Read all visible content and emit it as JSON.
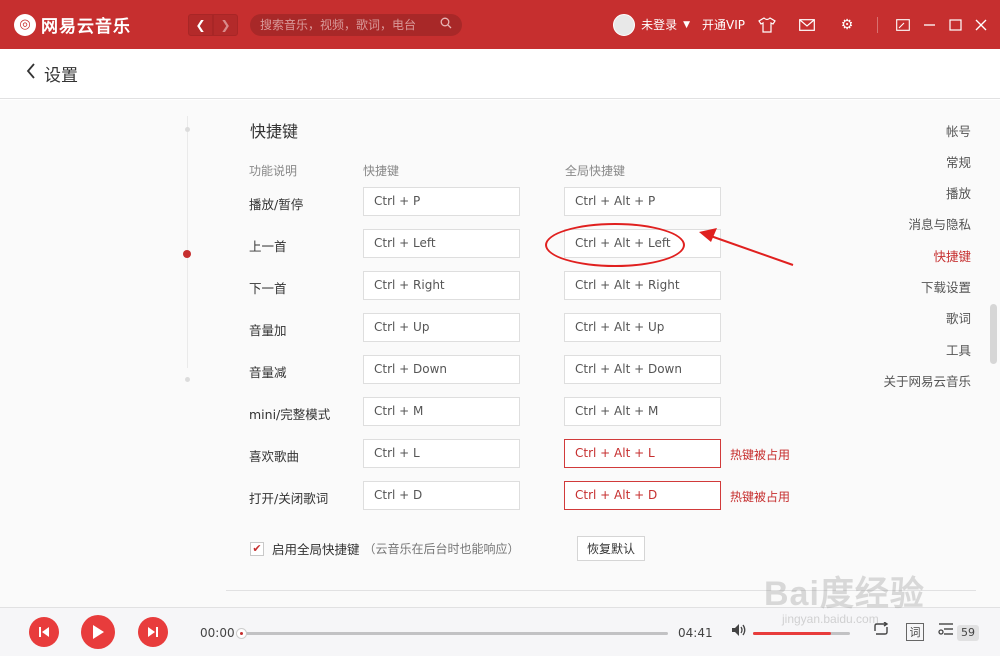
{
  "app": {
    "name": "网易云音乐",
    "logo_icon": "netease-logo-icon",
    "brand_color": "#c62f2f"
  },
  "titlebar": {
    "search_placeholder": "搜索音乐，视频，歌词，电台",
    "login_label": "未登录",
    "vip_label": "开通VIP"
  },
  "header": {
    "title": "设置"
  },
  "sidebar": {
    "items": [
      {
        "label": "帐号",
        "active": false
      },
      {
        "label": "常规",
        "active": false
      },
      {
        "label": "播放",
        "active": false
      },
      {
        "label": "消息与隐私",
        "active": false
      },
      {
        "label": "快捷键",
        "active": true
      },
      {
        "label": "下载设置",
        "active": false
      },
      {
        "label": "歌词",
        "active": false
      },
      {
        "label": "工具",
        "active": false
      },
      {
        "label": "关于网易云音乐",
        "active": false
      }
    ]
  },
  "shortcuts": {
    "section_title": "快捷键",
    "columns": {
      "function": "功能说明",
      "local": "快捷键",
      "global": "全局快捷键"
    },
    "rows": [
      {
        "label": "播放/暂停",
        "local": "Ctrl + P",
        "global": "Ctrl + Alt + P",
        "conflict": ""
      },
      {
        "label": "上一首",
        "local": "Ctrl + Left",
        "global": "Ctrl + Alt + Left",
        "conflict": ""
      },
      {
        "label": "下一首",
        "local": "Ctrl + Right",
        "global": "Ctrl + Alt + Right",
        "conflict": ""
      },
      {
        "label": "音量加",
        "local": "Ctrl + Up",
        "global": "Ctrl + Alt + Up",
        "conflict": ""
      },
      {
        "label": "音量减",
        "local": "Ctrl + Down",
        "global": "Ctrl + Alt + Down",
        "conflict": ""
      },
      {
        "label": "mini/完整模式",
        "local": "Ctrl + M",
        "global": "Ctrl + Alt + M",
        "conflict": ""
      },
      {
        "label": "喜欢歌曲",
        "local": "Ctrl + L",
        "global": "Ctrl + Alt + L",
        "conflict": "热键被占用"
      },
      {
        "label": "打开/关闭歌词",
        "local": "Ctrl + D",
        "global": "Ctrl + Alt + D",
        "conflict": "热键被占用"
      }
    ],
    "enable_global_label": "启用全局快捷键",
    "enable_global_note": "（云音乐在后台时也能响应）",
    "enable_global_checked": true,
    "reset_label": "恢复默认"
  },
  "player": {
    "current_time": "00:00",
    "total_time": "04:41",
    "progress": 0,
    "volume": 0.8,
    "lyric_label": "词",
    "playlist_count": "59"
  },
  "watermark": {
    "main": "Bai度经验",
    "sub": "jingyan.baidu.com"
  }
}
